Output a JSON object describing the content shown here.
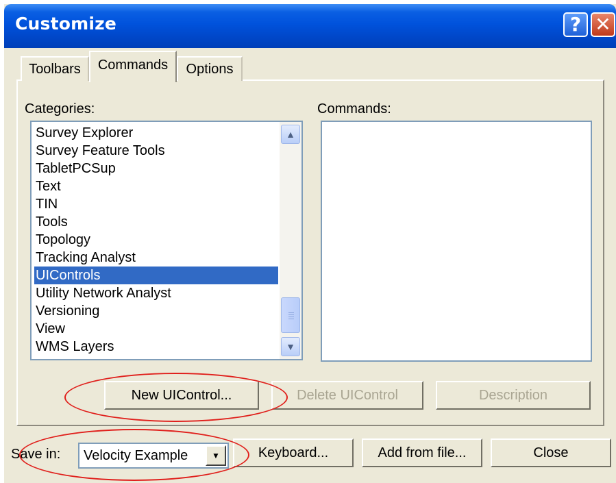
{
  "window": {
    "title": "Customize"
  },
  "title_buttons": {
    "help_glyph": "?",
    "close_glyph": "✕"
  },
  "tabs": [
    {
      "label": "Toolbars"
    },
    {
      "label": "Commands",
      "active": true
    },
    {
      "label": "Options"
    }
  ],
  "categories": {
    "label": "Categories:",
    "items": [
      "Survey Explorer",
      "Survey Feature Tools",
      "TabletPCSup",
      "Text",
      "TIN",
      "Tools",
      "Topology",
      "Tracking Analyst",
      "UIControls",
      "Utility Network Analyst",
      "Versioning",
      "View",
      "WMS Layers"
    ],
    "selected": "UIControls"
  },
  "commands": {
    "label": "Commands:"
  },
  "buttons": {
    "new_uicontrol": "New UIControl...",
    "delete_uicontrol": "Delete UIControl",
    "description": "Description",
    "keyboard": "Keyboard...",
    "add_from_file": "Add from file...",
    "close": "Close"
  },
  "save_in": {
    "label": "Save in:",
    "value": "Velocity Example"
  },
  "annotation_color": "#e0201c",
  "selection_color": "#316ac5"
}
